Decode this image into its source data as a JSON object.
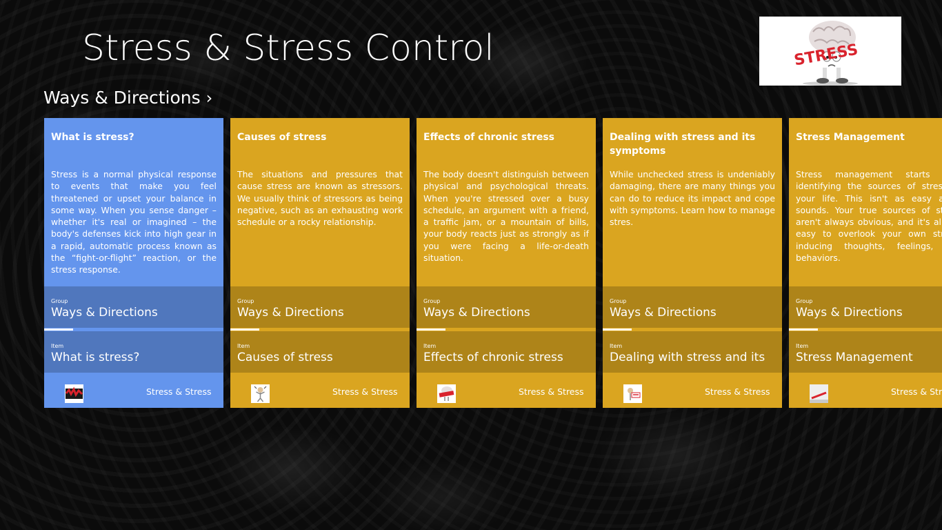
{
  "app": {
    "title": "Stress & Stress Control",
    "group_header": "Ways & Directions",
    "group_header_chevron": "›"
  },
  "colors": {
    "selected_tile": "#6495ED",
    "tile": "#DAA520",
    "background": "#0B0B0B"
  },
  "logo": {
    "icon": "stress-brain-logo",
    "text": "STRESS"
  },
  "tiles": [
    {
      "title": "What is stress?",
      "body": "Stress is a normal physical response to events that make you feel threatened or upset your balance in some way. When you sense danger – whether it's real or imagined – the body's defenses kick into high gear in a rapid, automatic process known as the “fight-or-flight” reaction, or the stress response.",
      "group_label": "Group",
      "group_value": "Ways & Directions",
      "item_label": "Item",
      "item_value": "What is stress?",
      "source": "Stress & Stress",
      "thumb_icon": "stress-thumbnail-icon"
    },
    {
      "title": "Causes of stress",
      "body": "The situations and pressures that cause stress are known as stressors. We usually think of stressors as being negative, such as an exhausting work schedule or a rocky relationship.",
      "group_label": "Group",
      "group_value": "Ways & Directions",
      "item_label": "Item",
      "item_value": "Causes of stress",
      "source": "Stress & Stress",
      "thumb_icon": "person-stressed-thumbnail-icon"
    },
    {
      "title": "Effects of chronic stress",
      "body": "The body doesn't distinguish between physical and psychological threats. When you're stressed over a busy schedule, an argument with a friend, a traffic jam, or a mountain of bills, your body reacts just as strongly as if you were facing a life-or-death situation.",
      "group_label": "Group",
      "group_value": "Ways & Directions",
      "item_label": "Item",
      "item_value": "Effects of chronic stress",
      "source": "Stress & Stress",
      "thumb_icon": "stress-brain-thumbnail-icon"
    },
    {
      "title": "Dealing with stress and its symptoms",
      "body": "While unchecked stress is undeniably damaging, there are many things you can do to reduce its impact and cope with symptoms. Learn how to manage stres.",
      "group_label": "Group",
      "group_value": "Ways & Directions",
      "item_label": "Item",
      "item_value": "Dealing with stress and its symptoms",
      "source": "Stress & Stress",
      "thumb_icon": "stress-sign-thumbnail-icon"
    },
    {
      "title": "Stress Management",
      "body": "Stress management starts with identifying the sources of stress in your life. This isn't as easy as it sounds. Your true sources of stress aren't always obvious, and it's all too easy to overlook your own stress-inducing thoughts, feelings, and behaviors.",
      "group_label": "Group",
      "group_value": "Ways & Directions",
      "item_label": "Item",
      "item_value": "Stress Management",
      "source": "Stress & Stress",
      "thumb_icon": "stress-management-thumbnail-icon"
    }
  ]
}
